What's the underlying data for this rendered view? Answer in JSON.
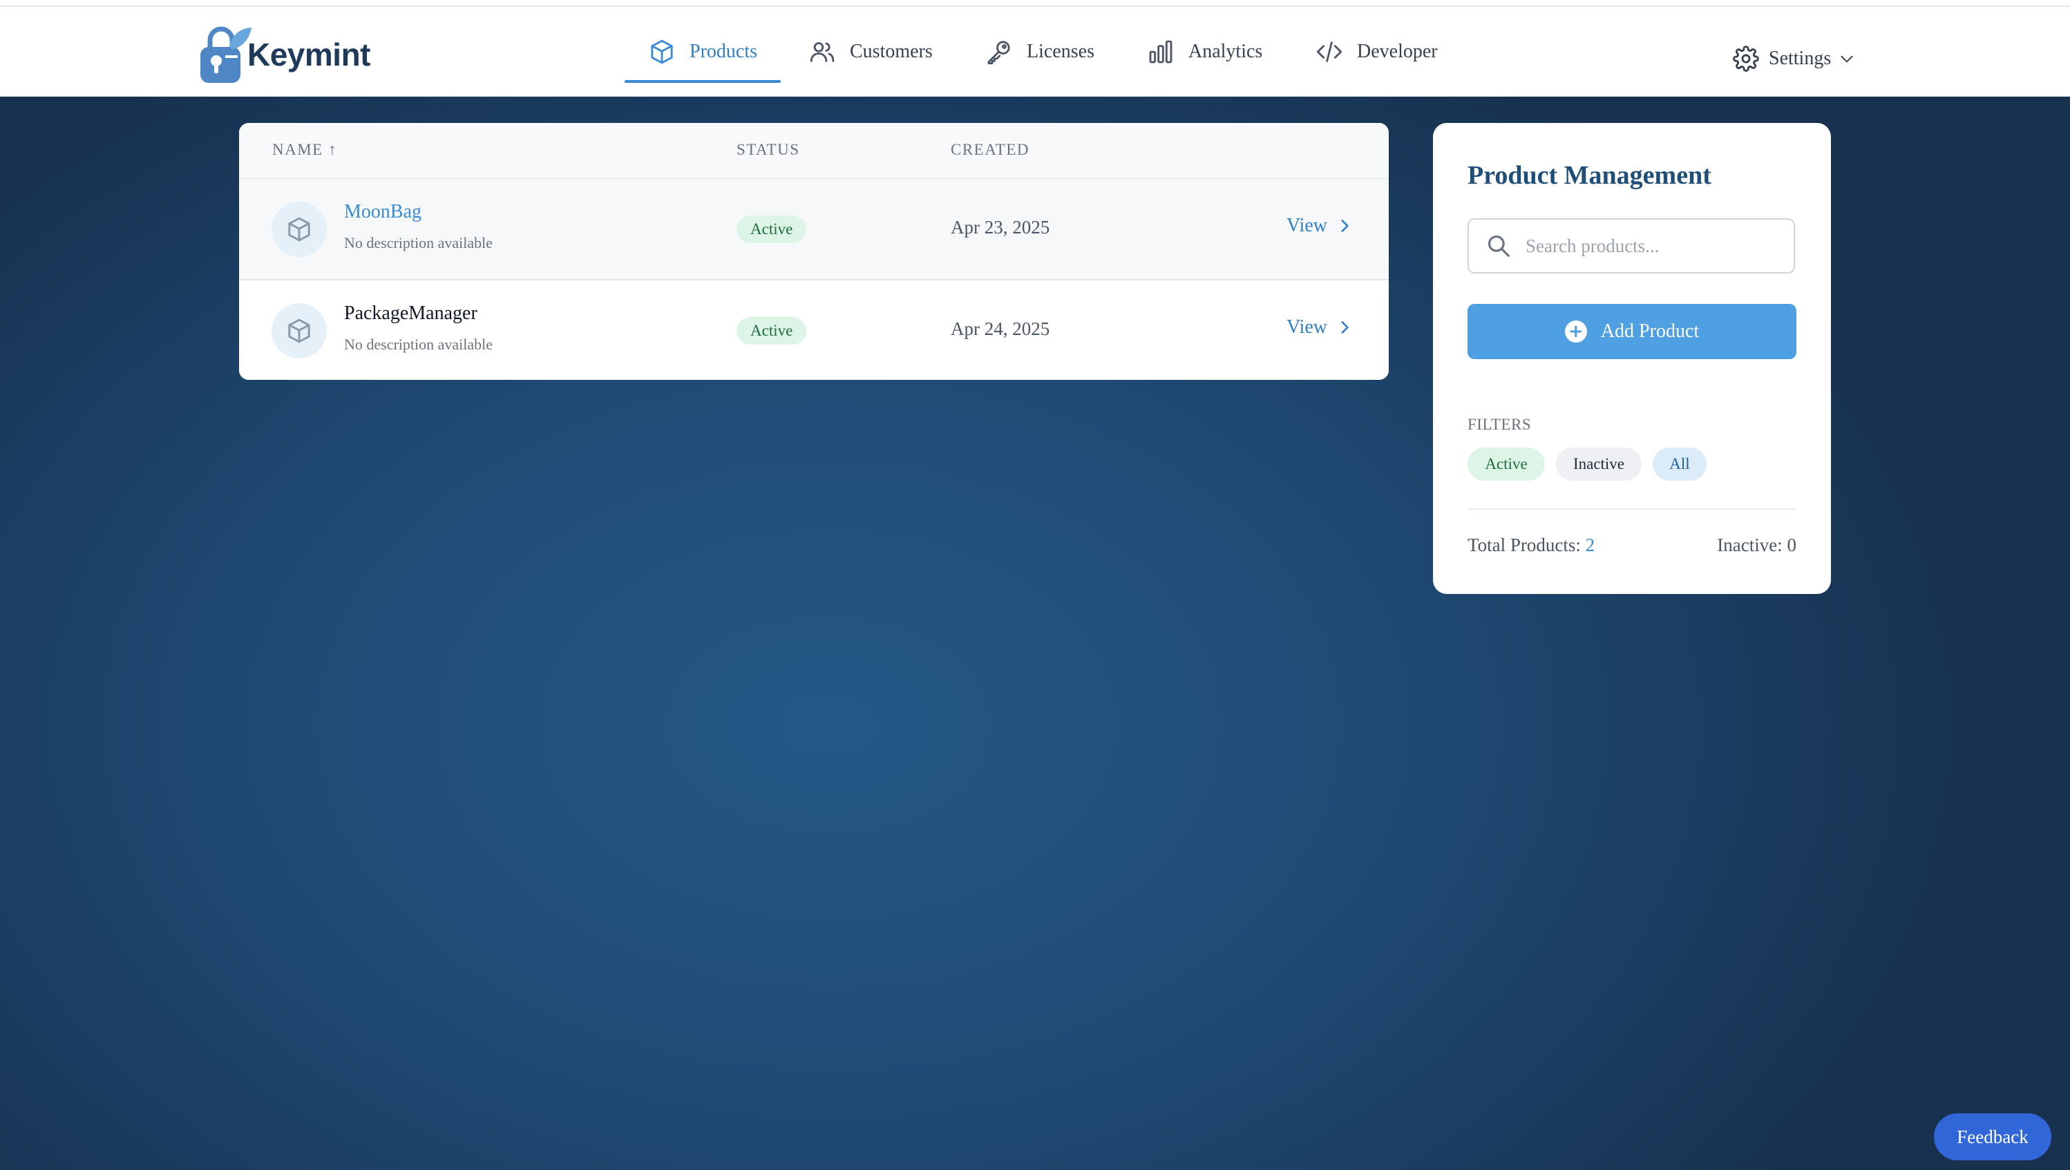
{
  "brand": {
    "name": "Keymint"
  },
  "nav": {
    "items": [
      {
        "label": "Products",
        "icon": "box-icon",
        "active": true
      },
      {
        "label": "Customers",
        "icon": "users-icon"
      },
      {
        "label": "Licenses",
        "icon": "key-icon"
      },
      {
        "label": "Analytics",
        "icon": "bar-chart-icon"
      },
      {
        "label": "Developer",
        "icon": "code-icon"
      }
    ],
    "settings_label": "Settings"
  },
  "table": {
    "headers": {
      "name": "NAME ↑",
      "status": "STATUS",
      "created": "CREATED"
    },
    "rows": [
      {
        "name": "MoonBag",
        "description": "No description available",
        "status": "Active",
        "created": "Apr 23, 2025",
        "action": "View"
      },
      {
        "name": "PackageManager",
        "description": "No description available",
        "status": "Active",
        "created": "Apr 24, 2025",
        "action": "View"
      }
    ]
  },
  "sidebar": {
    "title": "Product Management",
    "search_placeholder": "Search products...",
    "add_button": "Add Product",
    "filters_label": "FILTERS",
    "filters": [
      "Active",
      "Inactive",
      "All"
    ],
    "total_label": "Total Products:",
    "total_count": "2",
    "inactive_text": "Inactive: 0"
  },
  "feedback_label": "Feedback",
  "colors": {
    "accent": "#3a8bd2",
    "button": "#4fa0e2",
    "feedback": "#3066d8",
    "badge_bg": "#dcf5e6"
  }
}
